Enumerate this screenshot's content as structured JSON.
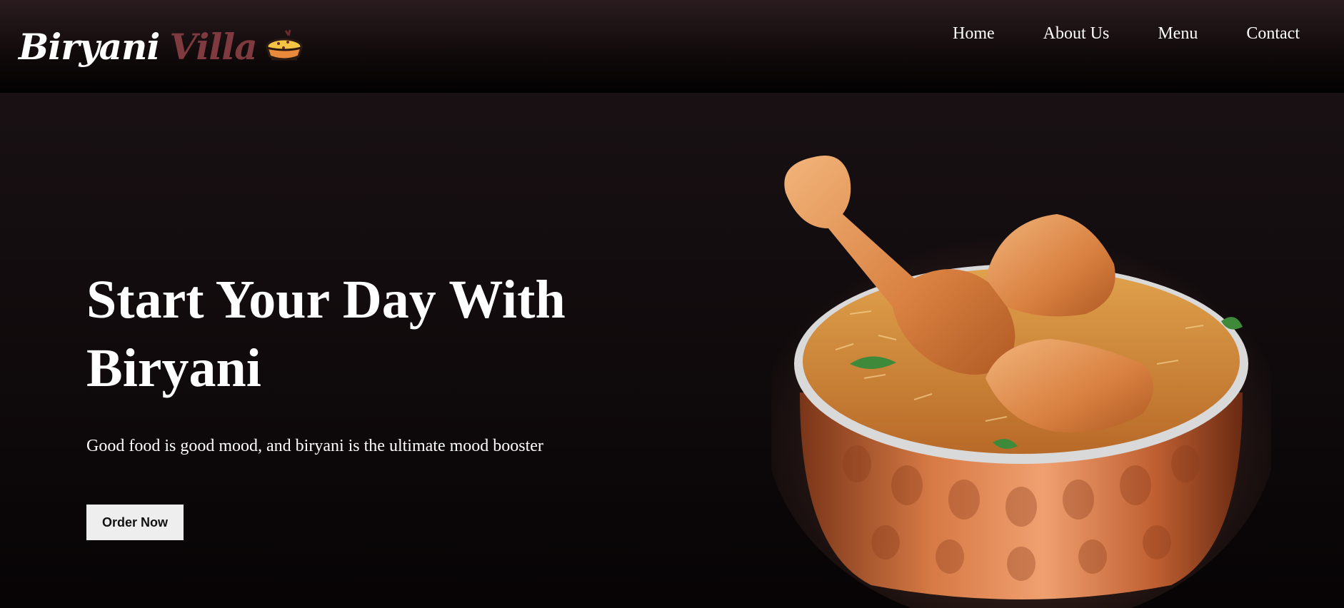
{
  "brand": {
    "name_part1": "Biryani",
    "name_part2": "Villa",
    "icon": "biryani-bowl-icon",
    "color_part2": "#7e3a3e"
  },
  "nav": {
    "items": [
      {
        "label": "Home"
      },
      {
        "label": "About Us"
      },
      {
        "label": "Menu"
      },
      {
        "label": "Contact"
      }
    ]
  },
  "hero": {
    "title": "Start Your Day With Biryani",
    "subtitle": "Good food is good mood, and biryani is the ultimate mood booster",
    "cta_label": "Order Now",
    "image": "biryani-pot-illustration"
  },
  "colors": {
    "background": "#120b0d",
    "text": "#ffffff",
    "button_bg": "#eeeeee",
    "copper": "#c46a3b"
  }
}
